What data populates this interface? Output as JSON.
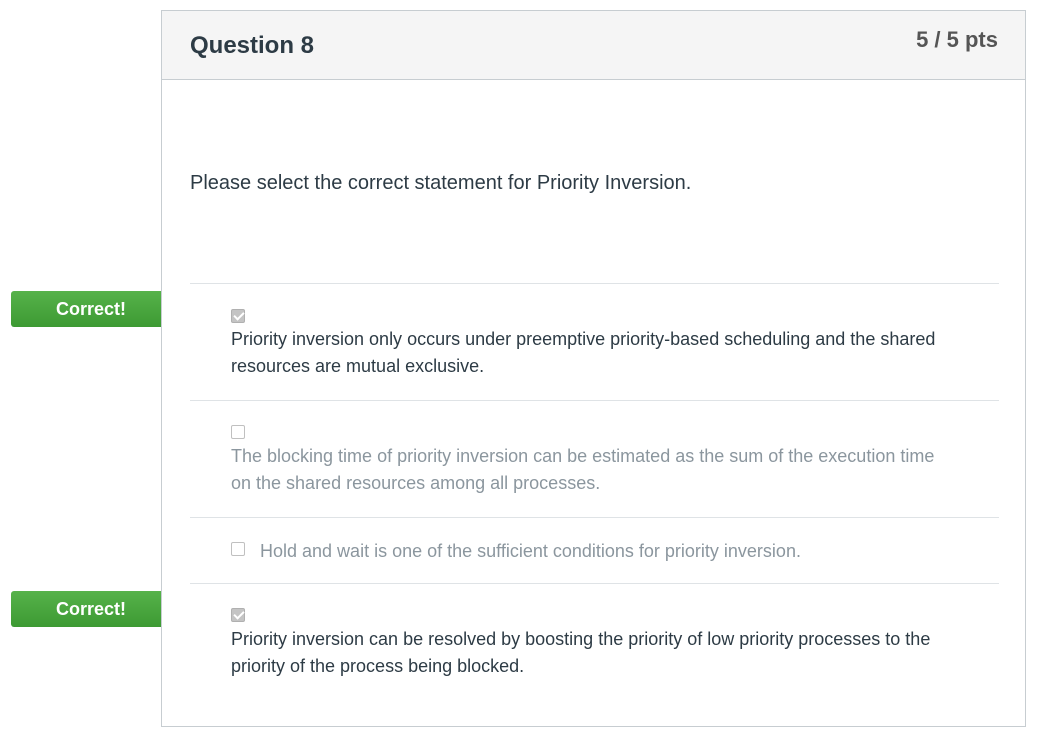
{
  "question": {
    "title": "Question 8",
    "points": "5 / 5 pts",
    "text": "Please select the correct statement for Priority Inversion."
  },
  "answers": [
    {
      "text": "Priority inversion only occurs under preemptive priority-based scheduling and the shared resources are mutual exclusive.",
      "checked": true,
      "status": "correct"
    },
    {
      "text": "The blocking time of priority inversion can be estimated as the sum of the execution time on the shared resources among all processes.",
      "checked": false,
      "status": "unselected"
    },
    {
      "text": "Hold and wait is one of the sufficient conditions for priority inversion.",
      "checked": false,
      "status": "unselected"
    },
    {
      "text": "Priority inversion can be resolved by boosting the priority of low priority processes to the priority of the process being blocked.",
      "checked": true,
      "status": "correct"
    }
  ],
  "flags": [
    {
      "label": "Correct!"
    },
    {
      "label": "Correct!"
    }
  ],
  "colors": {
    "flag_green": "#47a63c",
    "header_bg": "#f5f5f5",
    "text_dark": "#2d3b45",
    "text_muted": "#8b969e"
  }
}
